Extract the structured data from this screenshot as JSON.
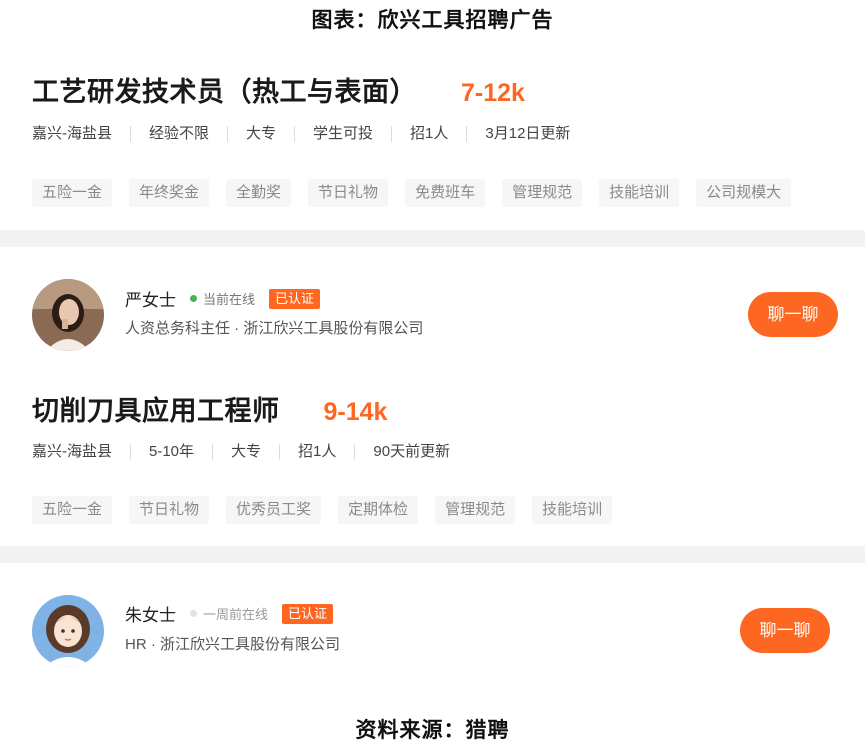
{
  "figure_title": "图表：欣兴工具招聘广告",
  "source": "资料来源：猎聘",
  "jobs": [
    {
      "title": "工艺研发技术员（热工与表面）",
      "salary": "7-12k",
      "meta": [
        "嘉兴-海盐县",
        "经验不限",
        "大专",
        "学生可投",
        "招1人",
        "3月12日更新"
      ],
      "tags": [
        "五险一金",
        "年终奖金",
        "全勤奖",
        "节日礼物",
        "免费班车",
        "管理规范",
        "技能培训",
        "公司规模大"
      ],
      "recruiter": {
        "name": "严女士",
        "status": "当前在线",
        "status_color": "#4caf50",
        "verified": "已认证",
        "subtitle": "人资总务科主任 · 浙江欣兴工具股份有限公司",
        "chat": "聊一聊"
      }
    },
    {
      "title": "切削刀具应用工程师",
      "salary": "9-14k",
      "meta": [
        "嘉兴-海盐县",
        "5-10年",
        "大专",
        "招1人",
        "90天前更新"
      ],
      "tags": [
        "五险一金",
        "节日礼物",
        "优秀员工奖",
        "定期体检",
        "管理规范",
        "技能培训"
      ],
      "recruiter": {
        "name": "朱女士",
        "status": "一周前在线",
        "status_color": "#d8d8d8",
        "verified": "已认证",
        "subtitle": "HR · 浙江欣兴工具股份有限公司",
        "chat": "聊一聊"
      }
    }
  ],
  "colors": {
    "accent": "#fd6722",
    "tag_bg": "#f6f6f6",
    "separator": "#f3f3f3"
  }
}
